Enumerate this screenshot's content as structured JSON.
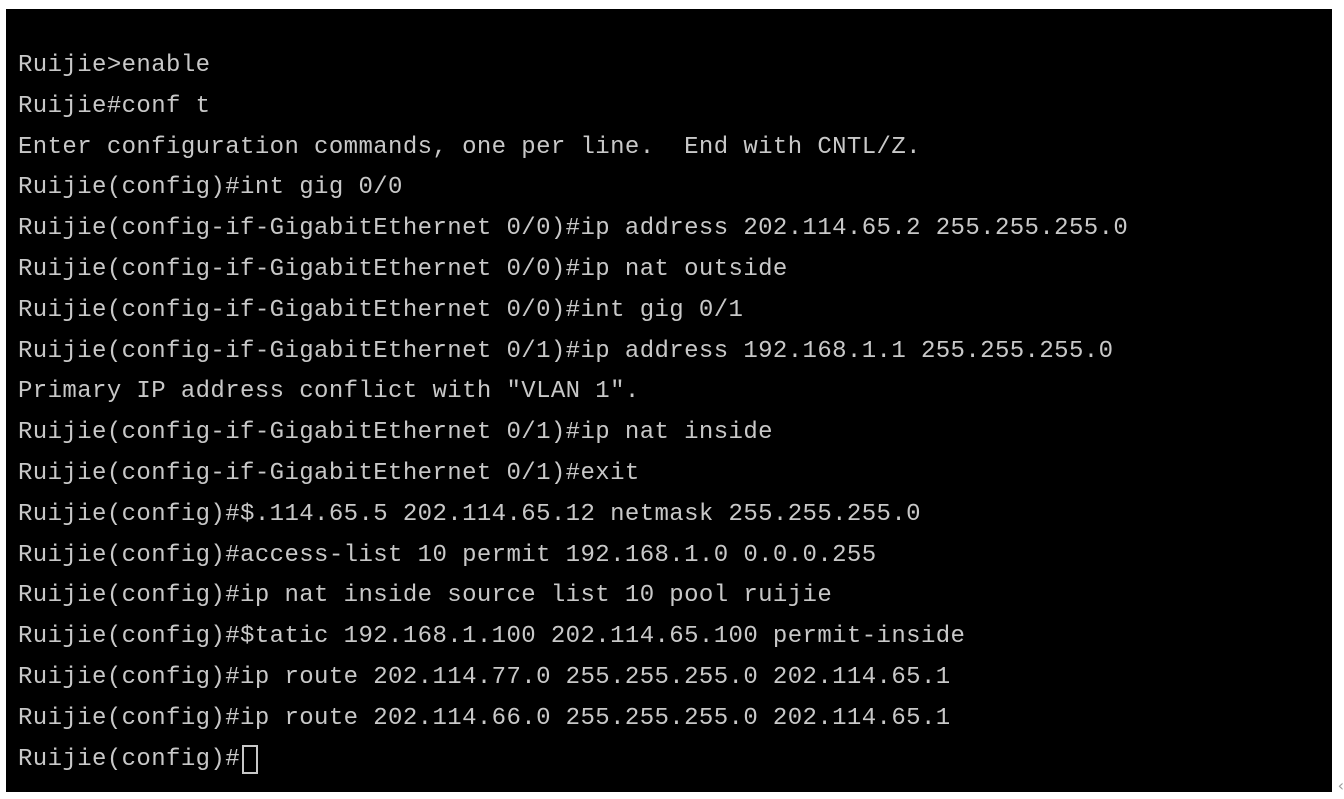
{
  "terminal": {
    "lines": [
      "Ruijie>enable",
      "Ruijie#conf t",
      "Enter configuration commands, one per line.  End with CNTL/Z.",
      "Ruijie(config)#int gig 0/0",
      "Ruijie(config-if-GigabitEthernet 0/0)#ip address 202.114.65.2 255.255.255.0",
      "Ruijie(config-if-GigabitEthernet 0/0)#ip nat outside",
      "Ruijie(config-if-GigabitEthernet 0/0)#int gig 0/1",
      "Ruijie(config-if-GigabitEthernet 0/1)#ip address 192.168.1.1 255.255.255.0",
      "Primary IP address conflict with \"VLAN 1\".",
      "Ruijie(config-if-GigabitEthernet 0/1)#ip nat inside",
      "Ruijie(config-if-GigabitEthernet 0/1)#exit",
      "Ruijie(config)#$.114.65.5 202.114.65.12 netmask 255.255.255.0",
      "Ruijie(config)#access-list 10 permit 192.168.1.0 0.0.0.255",
      "Ruijie(config)#ip nat inside source list 10 pool ruijie",
      "Ruijie(config)#$tatic 192.168.1.100 202.114.65.100 permit-inside",
      "Ruijie(config)#ip route 202.114.77.0 255.255.255.0 202.114.65.1",
      "Ruijie(config)#ip route 202.114.66.0 255.255.255.0 202.114.65.1"
    ],
    "prompt": "Ruijie(config)#",
    "colors": {
      "background": "#000000",
      "text": "#c8c8c8"
    },
    "resize_icon": "resize-grip-icon"
  }
}
